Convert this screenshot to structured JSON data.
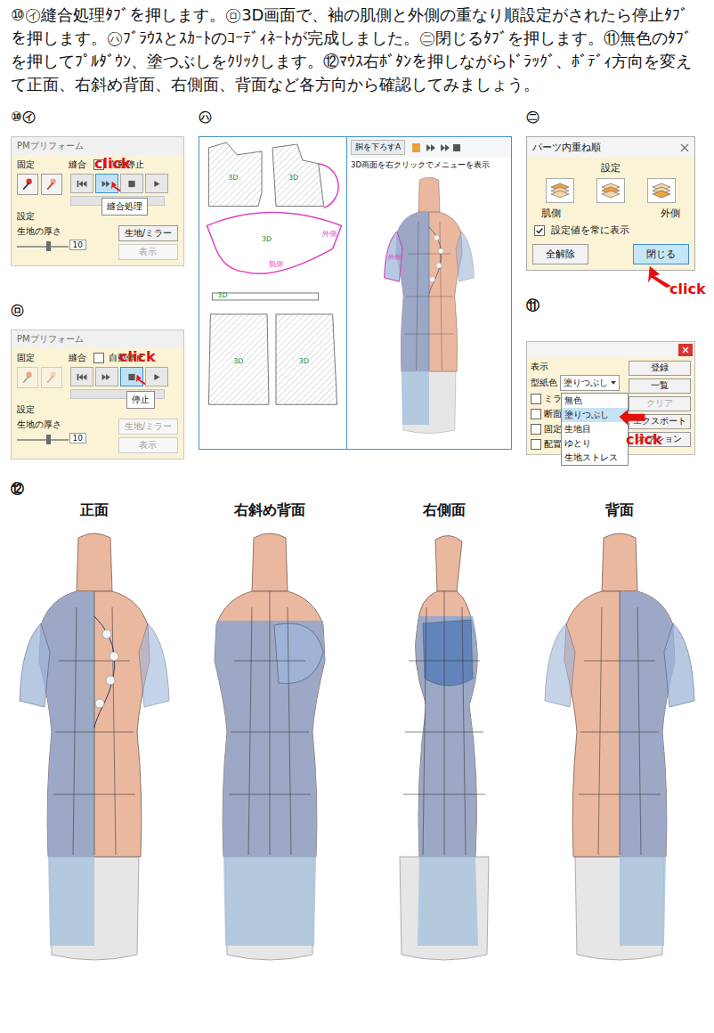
{
  "instructions": "⑩㋑縫合処理ﾀﾌﾞを押します。㋺3D画面で、袖の肌側と外側の重なり順設定がされたら停止ﾀﾌﾞを押します。㋩ﾌﾞﾗｳｽとｽｶｰﾄのｺｰﾃﾞｨﾈｰﾄが完成しました。㊁閉じるﾀﾌﾞを押します。⑪無色のﾀﾌﾞを押してﾌﾟﾙﾀﾞｳﾝ、塗つぶしをｸﾘｯｸします。⑫ﾏｳｽ右ﾎﾞﾀﾝを押しながらﾄﾞﾗｯｸﾞ、ﾎﾞﾃﾞｨ方向を変えて正面、右斜め背面、右側面、背面など各方向から確認してみましょう。",
  "preform_panels": [
    {
      "step": "⑩㋑",
      "title": "PMプリフォーム",
      "fixed_label": "固定",
      "sew_label": "縫合",
      "auto_stop": {
        "label": "自動停止",
        "checked": false
      },
      "settings_label": "設定",
      "thickness_label": "生地の厚さ",
      "thickness": "10",
      "thickness_level": 0.45,
      "tools_disabled": false,
      "controls": [
        {
          "kind": "rewind",
          "highlighted": false
        },
        {
          "kind": "sew",
          "highlighted": true
        },
        {
          "kind": "stop",
          "highlighted": false
        },
        {
          "kind": "play",
          "highlighted": false
        }
      ],
      "tooltip": "縫合処理",
      "buttons": [
        {
          "label": "生地/ミラー",
          "disabled": false
        },
        {
          "label": "表示",
          "disabled": true
        }
      ],
      "click": "click"
    },
    {
      "step": "㋺",
      "title": "PMプリフォーム",
      "fixed_label": "固定",
      "sew_label": "縫合",
      "auto_stop": {
        "label": "自動停止",
        "checked": false
      },
      "settings_label": "設定",
      "thickness_label": "生地の厚さ",
      "thickness": "10",
      "thickness_level": 0.45,
      "tools_disabled": true,
      "controls": [
        {
          "kind": "rewind",
          "highlighted": false
        },
        {
          "kind": "sew",
          "highlighted": false
        },
        {
          "kind": "stop",
          "highlighted": true
        },
        {
          "kind": "play",
          "highlighted": false
        }
      ],
      "tooltip": "停止",
      "buttons": [
        {
          "label": "生地/ミラー",
          "disabled": true
        },
        {
          "label": "表示",
          "disabled": true
        }
      ],
      "click": "click"
    }
  ],
  "coordinate_window": {
    "step": "㋩",
    "field": "胴を下ろすA",
    "hint": "3D画面を右クリックでメニューを表示",
    "view_tag": "外側",
    "pieces": [
      {
        "label": "3D",
        "tags": []
      },
      {
        "label": "3D",
        "tags": []
      },
      {
        "label": "3D",
        "tags": [
          "外側",
          "肌側"
        ]
      },
      {
        "label": "3D",
        "tags": []
      },
      {
        "label": "3D",
        "tags": []
      },
      {
        "label": "3D",
        "tags": []
      }
    ]
  },
  "layer_dialog": {
    "step": "㊁",
    "title": "パーツ内重ね順",
    "section": "設定",
    "layer_labels": [
      "肌側",
      "外側"
    ],
    "always_show": {
      "label": "設定値を常に表示",
      "checked": true
    },
    "buttons": [
      {
        "label": "全解除",
        "selected": false
      },
      {
        "label": "閉じる",
        "selected": true
      }
    ],
    "click": "click"
  },
  "display_panel": {
    "step": "⑪",
    "section": "表示",
    "color_label": "型紙色",
    "color_value": "塗りつぶし",
    "options": [
      {
        "label": "無色",
        "selected": false
      },
      {
        "label": "塗りつぶし",
        "selected": true
      },
      {
        "label": "生地目",
        "selected": false
      },
      {
        "label": "ゆとり",
        "selected": false
      },
      {
        "label": "生地ストレス",
        "selected": false
      }
    ],
    "checkboxes": [
      {
        "label": "ミラ",
        "checked": false
      },
      {
        "label": "断面",
        "checked": false
      },
      {
        "label": "固定",
        "checked": false
      },
      {
        "label": "配置",
        "checked": false
      }
    ],
    "buttons": [
      {
        "label": "登録",
        "disabled": false
      },
      {
        "label": "一覧",
        "disabled": false
      },
      {
        "label": "クリア",
        "disabled": true
      },
      {
        "label": "エクスポート",
        "disabled": false
      },
      {
        "label": "オプション",
        "disabled": false
      }
    ],
    "click": "click"
  },
  "views": {
    "step": "⑫",
    "items": [
      {
        "title": "正面",
        "kind": "front"
      },
      {
        "title": "右斜め背面",
        "kind": "diagonal"
      },
      {
        "title": "右側面",
        "kind": "side"
      },
      {
        "title": "背面",
        "kind": "back"
      }
    ]
  }
}
